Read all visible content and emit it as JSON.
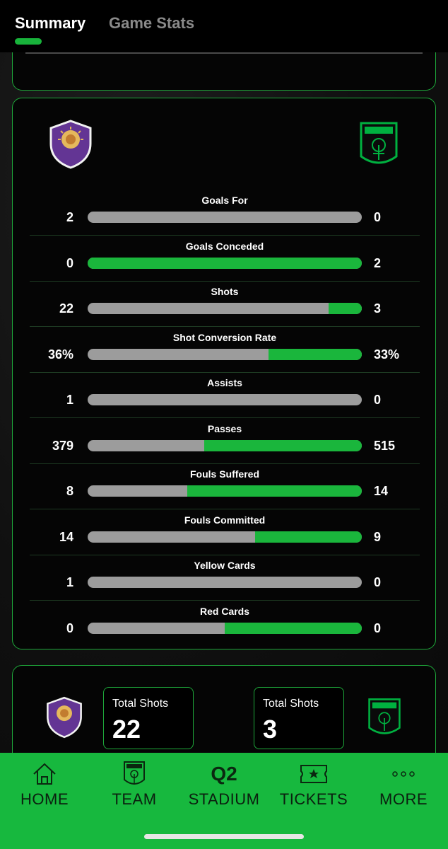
{
  "tabs": {
    "summary": "Summary",
    "game_stats": "Game Stats"
  },
  "colors": {
    "accent": "#1ab63c",
    "bar_bg": "#9c9c9c",
    "orlando_purple": "#633594",
    "austin_green": "#00b140"
  },
  "teams": {
    "home": {
      "crest_icon": "orlando-city-crest-icon",
      "crest_text": "ORLANDO CITY"
    },
    "away": {
      "crest_icon": "austin-fc-crest-icon",
      "crest_text": "AUSTIN"
    }
  },
  "stats": [
    {
      "label": "Goals For",
      "home": "2",
      "away": "0",
      "away_share": 0
    },
    {
      "label": "Goals Conceded",
      "home": "0",
      "away": "2",
      "away_share": 1
    },
    {
      "label": "Shots",
      "home": "22",
      "away": "3",
      "away_share": 0.12
    },
    {
      "label": "Shot Conversion Rate",
      "home": "36%",
      "away": "33%",
      "away_share": 0.34
    },
    {
      "label": "Assists",
      "home": "1",
      "away": "0",
      "away_share": 0
    },
    {
      "label": "Passes",
      "home": "379",
      "away": "515",
      "away_share": 0.576
    },
    {
      "label": "Fouls Suffered",
      "home": "8",
      "away": "14",
      "away_share": 0.636
    },
    {
      "label": "Fouls Committed",
      "home": "14",
      "away": "9",
      "away_share": 0.39
    },
    {
      "label": "Yellow Cards",
      "home": "1",
      "away": "0",
      "away_share": 0
    },
    {
      "label": "Red Cards",
      "home": "0",
      "away": "0",
      "away_share": 0.5
    }
  ],
  "total_shots": {
    "home_label": "Total Shots",
    "home_value": "22",
    "away_label": "Total Shots",
    "away_value": "3"
  },
  "nav": [
    {
      "label": "HOME",
      "icon": "home-icon"
    },
    {
      "label": "TEAM",
      "icon": "team-crest-icon"
    },
    {
      "label": "STADIUM",
      "icon": "q2-stadium-icon",
      "icon_text": "Q2"
    },
    {
      "label": "TICKETS",
      "icon": "ticket-icon"
    },
    {
      "label": "MORE",
      "icon": "more-dots-icon"
    }
  ]
}
